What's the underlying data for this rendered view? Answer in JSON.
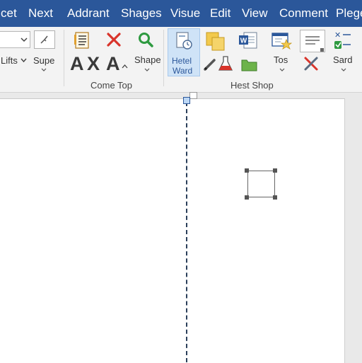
{
  "menu": {
    "items": [
      "cet",
      "Next",
      "Addrant",
      "Shages",
      "Visue",
      "Edit",
      "View",
      "Conment",
      "Plege"
    ]
  },
  "ribbon": {
    "font_dropdown_value": "",
    "lists_label": "Lifts",
    "supe_label": "Supe",
    "style_letters": [
      "A",
      "X",
      "A"
    ],
    "shape_label": "Shape",
    "hetel_ward_line1": "Hetel",
    "hetel_ward_line2": "Ward",
    "tos_label": "Tos",
    "sard_label": "Sard",
    "group1_label": "Come Top",
    "group2_label": "Hest Shop",
    "word_icon_letter": "W"
  },
  "colors": {
    "menubar": "#2b579a",
    "accent": "#2b579a",
    "selected_button": "#cfe3f7",
    "red_x": "#d9342b",
    "green": "#2e9a40",
    "yellow": "#f2c94c"
  }
}
